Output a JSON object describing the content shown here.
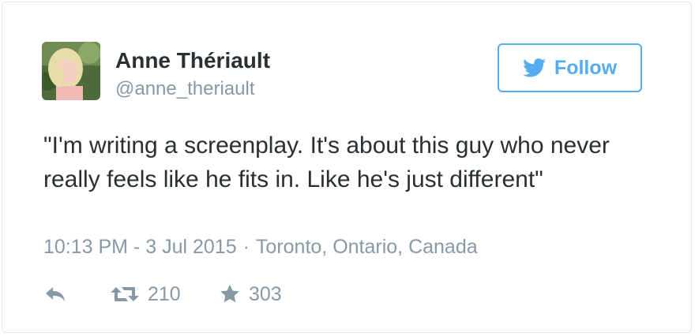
{
  "author": {
    "display_name": "Anne Thériault",
    "handle": "@anne_theriault"
  },
  "follow_button": {
    "label": "Follow",
    "icon": "twitter-bird-icon",
    "color": "#55acee"
  },
  "tweet": {
    "text": "\"I'm writing a screenplay. It's about this guy who never really feels like he fits in. Like he's just different\""
  },
  "meta": {
    "timestamp": "10:13 PM - 3 Jul 2015",
    "separator": "·",
    "location": "Toronto, Ontario, Canada"
  },
  "actions": {
    "reply": {
      "icon": "reply-icon"
    },
    "retweet": {
      "icon": "retweet-icon",
      "count": "210"
    },
    "favorite": {
      "icon": "star-icon",
      "count": "303"
    }
  },
  "colors": {
    "text": "#292f33",
    "muted": "#8899a6",
    "accent": "#55acee",
    "border": "#e1e8ed"
  }
}
